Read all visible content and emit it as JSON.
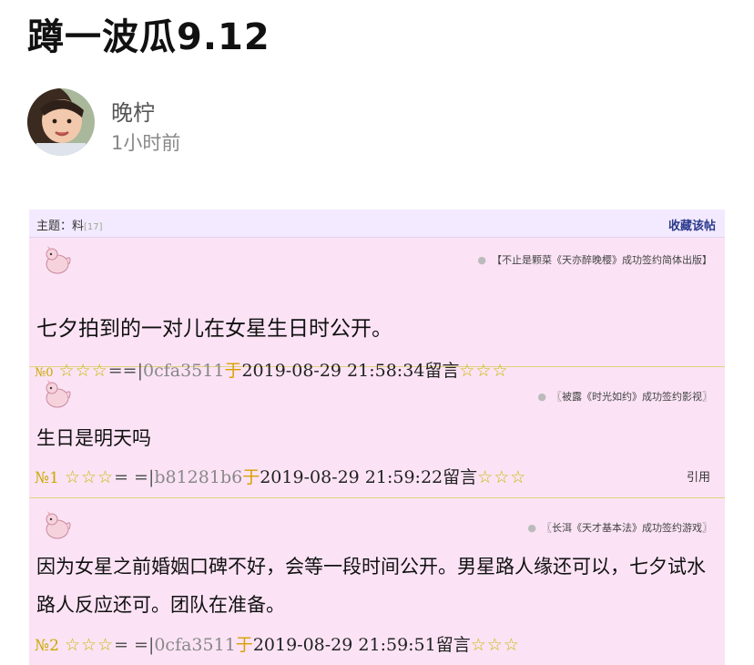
{
  "article": {
    "title": "蹲一波瓜9.12",
    "author": "晚柠",
    "time_ago": "1小时前"
  },
  "forum": {
    "topic_label": "主题：料",
    "topic_count": "[17]",
    "favorite_label": "收藏该帖",
    "posts": [
      {
        "signature": "【不止是颗菜《天亦醉晚樱》成功签约简体出版】",
        "content": "七夕拍到的一对儿在女星生日时公开。",
        "no": "№0",
        "stars_left": "☆☆☆",
        "sep": "==|",
        "user_id": "0cfa3511",
        "yu": "于",
        "datetime": "2019-08-29 21:58:34",
        "liuyan": "留言",
        "stars_right": "☆☆☆",
        "quote": ""
      },
      {
        "signature": "〖被露《时光如约》成功签约影视〗",
        "content": "生日是明天吗",
        "no": "№1",
        "stars_left": "☆☆☆",
        "sep": "= =|",
        "user_id": "b81281b6",
        "yu": "于",
        "datetime": "2019-08-29 21:59:22",
        "liuyan": "留言",
        "stars_right": "☆☆☆",
        "quote": "引用"
      },
      {
        "signature": "〖长洱《天才基本法》成功签约游戏〗",
        "content": "因为女星之前婚姻口碑不好，会等一段时间公开。男星路人缘还可以，七夕试水路人反应还可。团队在准备。",
        "no": "№2",
        "stars_left": "☆☆☆",
        "sep": "= =|",
        "user_id": "0cfa3511",
        "yu": "于",
        "datetime": "2019-08-29 21:59:51",
        "liuyan": "留言",
        "stars_right": "☆☆☆",
        "quote": ""
      }
    ]
  }
}
